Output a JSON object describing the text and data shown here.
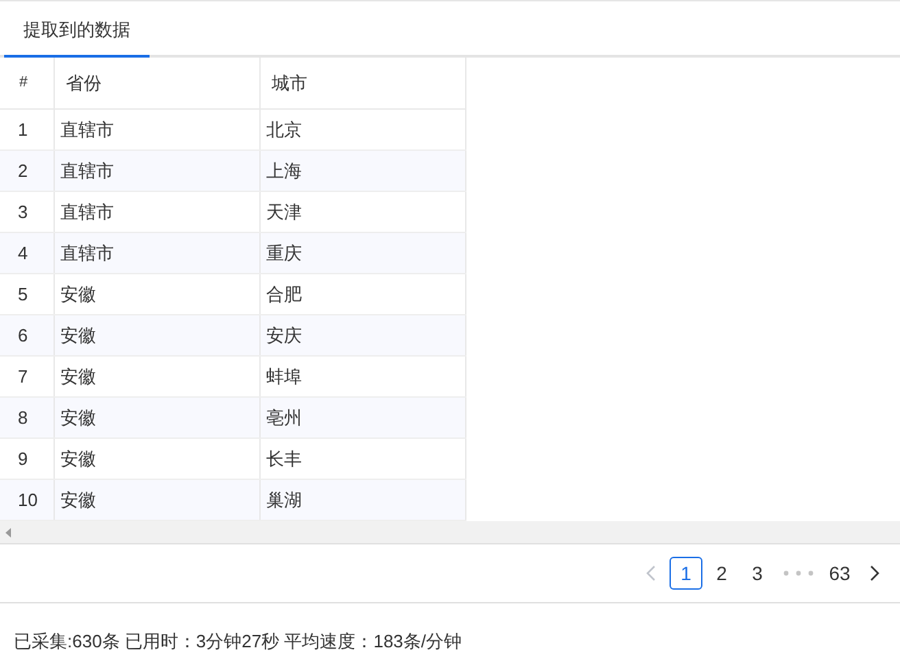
{
  "tabs": [
    {
      "label": "提取到的数据",
      "selected": true
    }
  ],
  "table": {
    "columns": [
      "#",
      "省份",
      "城市"
    ],
    "rows": [
      [
        "1",
        "直辖市",
        "北京"
      ],
      [
        "2",
        "直辖市",
        "上海"
      ],
      [
        "3",
        "直辖市",
        "天津"
      ],
      [
        "4",
        "直辖市",
        "重庆"
      ],
      [
        "5",
        "安徽",
        "合肥"
      ],
      [
        "6",
        "安徽",
        "安庆"
      ],
      [
        "7",
        "安徽",
        "蚌埠"
      ],
      [
        "8",
        "安徽",
        "亳州"
      ],
      [
        "9",
        "安徽",
        "长丰"
      ],
      [
        "10",
        "安徽",
        "巢湖"
      ]
    ]
  },
  "pagination": {
    "prev_disabled": true,
    "next_disabled": false,
    "items": [
      {
        "kind": "page",
        "label": "1",
        "selected": true
      },
      {
        "kind": "page",
        "label": "2",
        "selected": false
      },
      {
        "kind": "page",
        "label": "3",
        "selected": false
      },
      {
        "kind": "ellipsis"
      },
      {
        "kind": "page",
        "label": "63",
        "selected": false
      }
    ]
  },
  "status_bar": "已采集:630条 已用时：3分钟27秒 平均速度：183条/分钟"
}
